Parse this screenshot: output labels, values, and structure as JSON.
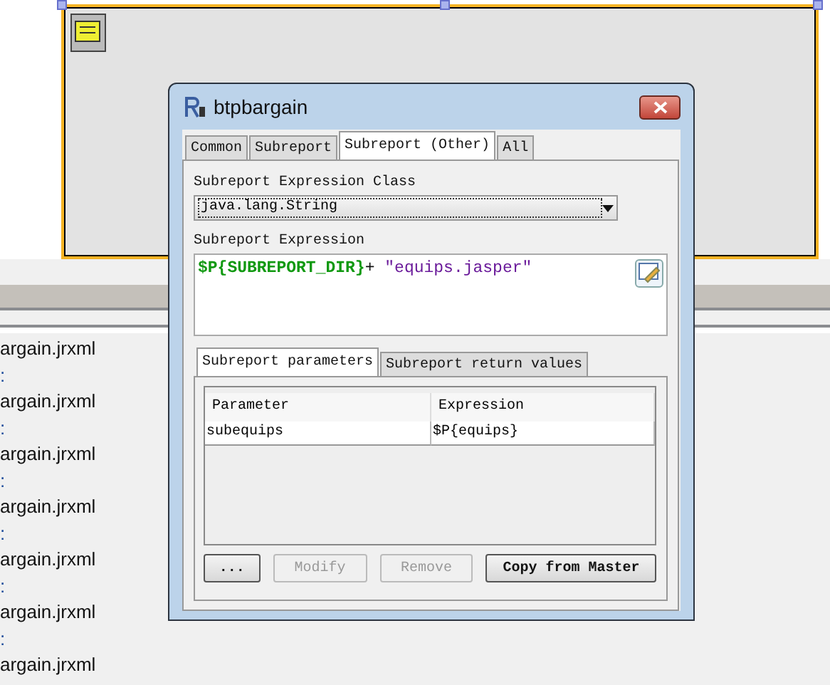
{
  "log_lines": [
    {
      "text": "argain.jrxml"
    },
    {
      "text": ":"
    },
    {
      "text": "argain.jrxml"
    },
    {
      "text": ":"
    },
    {
      "text": "argain.jrxml"
    },
    {
      "text": ":"
    },
    {
      "text": "argain.jrxml"
    },
    {
      "text": ":"
    },
    {
      "text": "argain.jrxml"
    },
    {
      "text": ":"
    },
    {
      "text": "argain.jrxml"
    },
    {
      "text": ":"
    },
    {
      "text": "argain.jrxml"
    }
  ],
  "dialog": {
    "title": "btpbargain",
    "tabs": [
      {
        "label": "Common",
        "selected": false
      },
      {
        "label": "Subreport",
        "selected": false
      },
      {
        "label": "Subreport (Other)",
        "selected": true
      },
      {
        "label": "All",
        "selected": false
      }
    ],
    "class_label": "Subreport Expression Class",
    "class_value": "java.lang.String",
    "expression_label": "Subreport Expression",
    "expression_parts": [
      {
        "text": "$P{SUBREPORT_DIR}",
        "kind": "param"
      },
      {
        "text": "+ ",
        "kind": "op"
      },
      {
        "text": "\"equips.jasper\"",
        "kind": "string"
      }
    ],
    "sub_tabs": [
      {
        "label": "Subreport parameters",
        "selected": true
      },
      {
        "label": "Subreport return values",
        "selected": false
      }
    ],
    "table": {
      "columns": [
        "Parameter",
        "Expression"
      ],
      "rows": [
        [
          "subequips",
          "$P{equips}"
        ]
      ]
    },
    "buttons": [
      {
        "label": "...",
        "disabled": false
      },
      {
        "label": "Modify",
        "disabled": true
      },
      {
        "label": "Remove",
        "disabled": true
      },
      {
        "label": "Copy from Master",
        "disabled": false
      }
    ]
  }
}
